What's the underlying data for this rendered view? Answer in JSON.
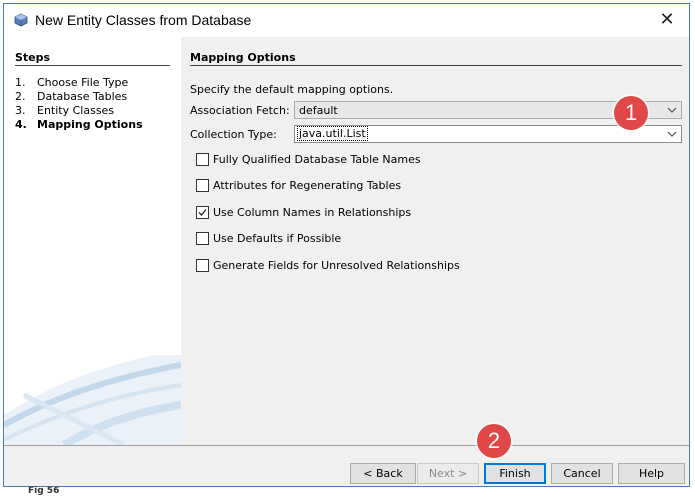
{
  "window": {
    "title": "New Entity Classes from Database",
    "close_glyph": "✕"
  },
  "steps": {
    "heading": "Steps",
    "items": [
      {
        "num": "1.",
        "label": "Choose File Type"
      },
      {
        "num": "2.",
        "label": "Database Tables"
      },
      {
        "num": "3.",
        "label": "Entity Classes"
      },
      {
        "num": "4.",
        "label": "Mapping Options"
      }
    ]
  },
  "main": {
    "heading": "Mapping Options",
    "description": "Specify the default mapping options.",
    "association_fetch": {
      "label": "Association Fetch:",
      "value": "default"
    },
    "collection_type": {
      "label": "Collection Type:",
      "value": "java.util.List"
    },
    "checkboxes": [
      {
        "label": "Fully Qualified Database Table Names",
        "checked": false
      },
      {
        "label": "Attributes for Regenerating Tables",
        "checked": false
      },
      {
        "label": "Use Column Names in Relationships",
        "checked": true
      },
      {
        "label": "Use Defaults if Possible",
        "checked": false
      },
      {
        "label": "Generate Fields for Unresolved Relationships",
        "checked": false
      }
    ]
  },
  "annotations": {
    "badge1": "1",
    "badge2": "2"
  },
  "footer": {
    "back": "< Back",
    "next": "Next >",
    "finish": "Finish",
    "cancel": "Cancel",
    "help": "Help"
  },
  "caption": "Fig 56",
  "colors": {
    "badge": "#e04848",
    "window_border": "#4a7ab8",
    "panel": "#f0f0f0"
  }
}
